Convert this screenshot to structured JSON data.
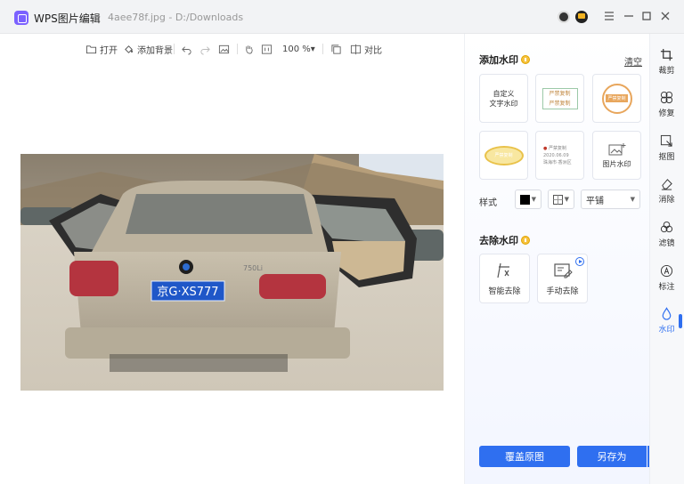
{
  "titlebar": {
    "app_title": "WPS图片编辑",
    "file_name": "4aee78f.jpg - D:/Downloads",
    "window_buttons": [
      "menu-icon",
      "minimize-icon",
      "maximize-icon",
      "close-icon"
    ]
  },
  "toolbar": {
    "open_label": "打开",
    "add_bg_label": "添加背景",
    "zoom_label": "100 %▾",
    "compare_label": "对比"
  },
  "image": {
    "plate_text": "京G·XS777",
    "badge_text": "750Li"
  },
  "add_watermark": {
    "title": "添加水印",
    "clear_label": "清空",
    "custom_text_card": "自定义\n文字水印",
    "stamp_text": "严禁复制",
    "stamp_text_repeat": "严禁复制",
    "location_date": "2020.06.09",
    "location_place": "珠海市·香洲区",
    "image_wm_label": "图片水印",
    "style_label": "样式",
    "style_color": "#000000",
    "tile_option": "平铺"
  },
  "remove_watermark": {
    "title": "去除水印",
    "smart_label": "智能去除",
    "manual_label": "手动去除"
  },
  "actions": {
    "overwrite_label": "覆盖原图",
    "save_as_label": "另存为"
  },
  "rightbar": {
    "items": [
      {
        "label": "裁剪",
        "icon": "crop-icon"
      },
      {
        "label": "修复",
        "icon": "repair-icon"
      },
      {
        "label": "抠图",
        "icon": "cutout-icon"
      },
      {
        "label": "消除",
        "icon": "eraser-icon"
      },
      {
        "label": "滤镜",
        "icon": "filter-icon"
      },
      {
        "label": "标注",
        "icon": "annotate-icon"
      },
      {
        "label": "水印",
        "icon": "watermark-icon"
      }
    ]
  },
  "colors": {
    "accent": "#2f6ff0",
    "coin": "#f6c23e"
  }
}
